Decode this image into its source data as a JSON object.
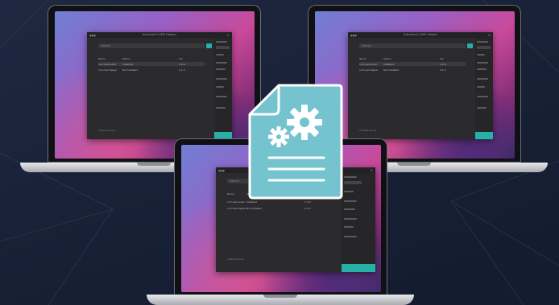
{
  "app": {
    "window_title": "ActivatorX (UEM Helper)",
    "search_placeholder": "Search",
    "columns": [
      "Name",
      "Status",
      "Ver"
    ],
    "rows": [
      {
        "name": "com.dell.audio",
        "status": "Installed",
        "ver": "1.0.0"
      },
      {
        "name": "com.dell.helper",
        "status": "Not Installed",
        "ver": "2.1.4"
      }
    ],
    "status_text": "2 items found"
  },
  "colors": {
    "accent": "#27b0a8",
    "icon_fill": "#74c3ce",
    "background": "#1a2236"
  },
  "icons": {
    "center": "document-settings-icon"
  }
}
